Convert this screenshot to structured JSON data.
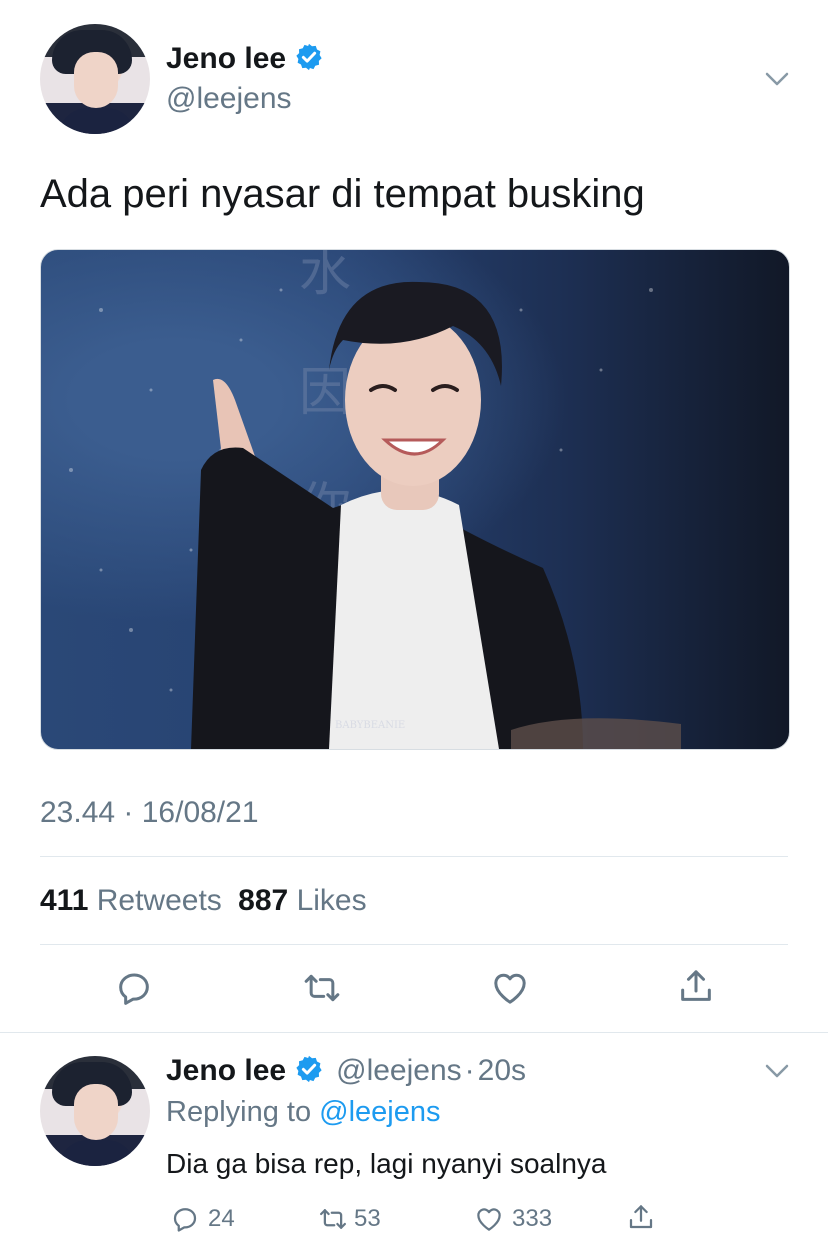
{
  "tweet": {
    "author_name": "Jeno lee",
    "author_handle": "@leejens",
    "text": "Ada peri nyasar di tempat busking",
    "photo_watermark": "BABYBEANIE",
    "time": "23.44 · 16/08/21",
    "retweets_count": "411",
    "retweets_label": "Retweets",
    "likes_count": "887",
    "likes_label": "Likes",
    "icons": [
      "reply-icon",
      "retweet-icon",
      "like-icon",
      "share-icon",
      "verified-badge-icon",
      "chevron-down-icon"
    ]
  },
  "reply": {
    "author_name": "Jeno lee",
    "author_handle": "@leejens",
    "time_sep": "·",
    "time": "20s",
    "replying_prefix": "Replying to",
    "replying_to": "@leejens",
    "text": "Dia ga bisa rep, lagi nyanyi soalnya",
    "reply_count": "24",
    "retweet_count": "53",
    "like_count": "333"
  },
  "colors": {
    "text": "#14171a",
    "secondary": "#657786",
    "link": "#1d9bf0",
    "divider": "#e1e8ed",
    "verified": "#1d9bf0"
  }
}
